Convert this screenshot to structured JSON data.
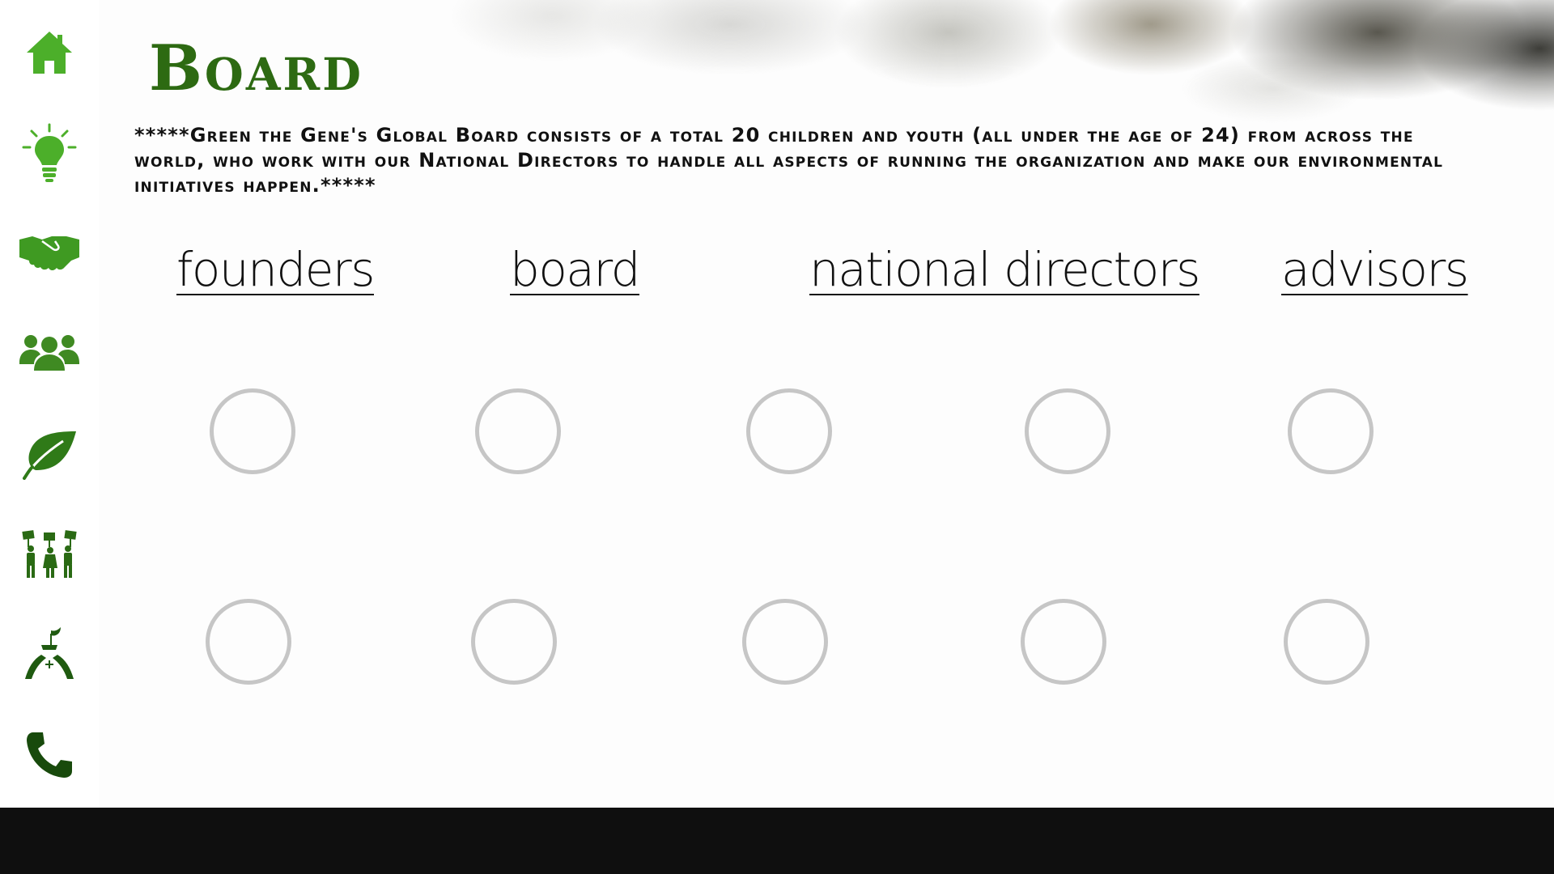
{
  "page": {
    "title": "Board",
    "intro": "*****Green the Gene's Global Board consists of a total 20 children and youth (all under the age of 24) from across the world, who work with our National Directors to handle all aspects of running the organization and make our environmental initiatives happen.*****"
  },
  "sidebar": {
    "items": [
      {
        "icon": "home-icon",
        "color": "#4caf2a"
      },
      {
        "icon": "lightbulb-icon",
        "color": "#4caf2a"
      },
      {
        "icon": "handshake-icon",
        "color": "#3f9a22"
      },
      {
        "icon": "group-icon",
        "color": "#3f8a22"
      },
      {
        "icon": "leaf-icon",
        "color": "#2f7a18"
      },
      {
        "icon": "activists-icon",
        "color": "#2a6a14"
      },
      {
        "icon": "hands-plant-icon",
        "color": "#1f5a10"
      },
      {
        "icon": "phone-icon",
        "color": "#184a0c"
      }
    ]
  },
  "tabs": [
    {
      "label": "founders"
    },
    {
      "label": "board"
    },
    {
      "label": "national directors"
    },
    {
      "label": "advisors"
    }
  ],
  "members": {
    "rows": 2,
    "per_row": 5
  },
  "colors": {
    "brand_green": "#2d6a12",
    "circle_outline": "#c6c6c6",
    "footer": "#0f0f0f"
  }
}
